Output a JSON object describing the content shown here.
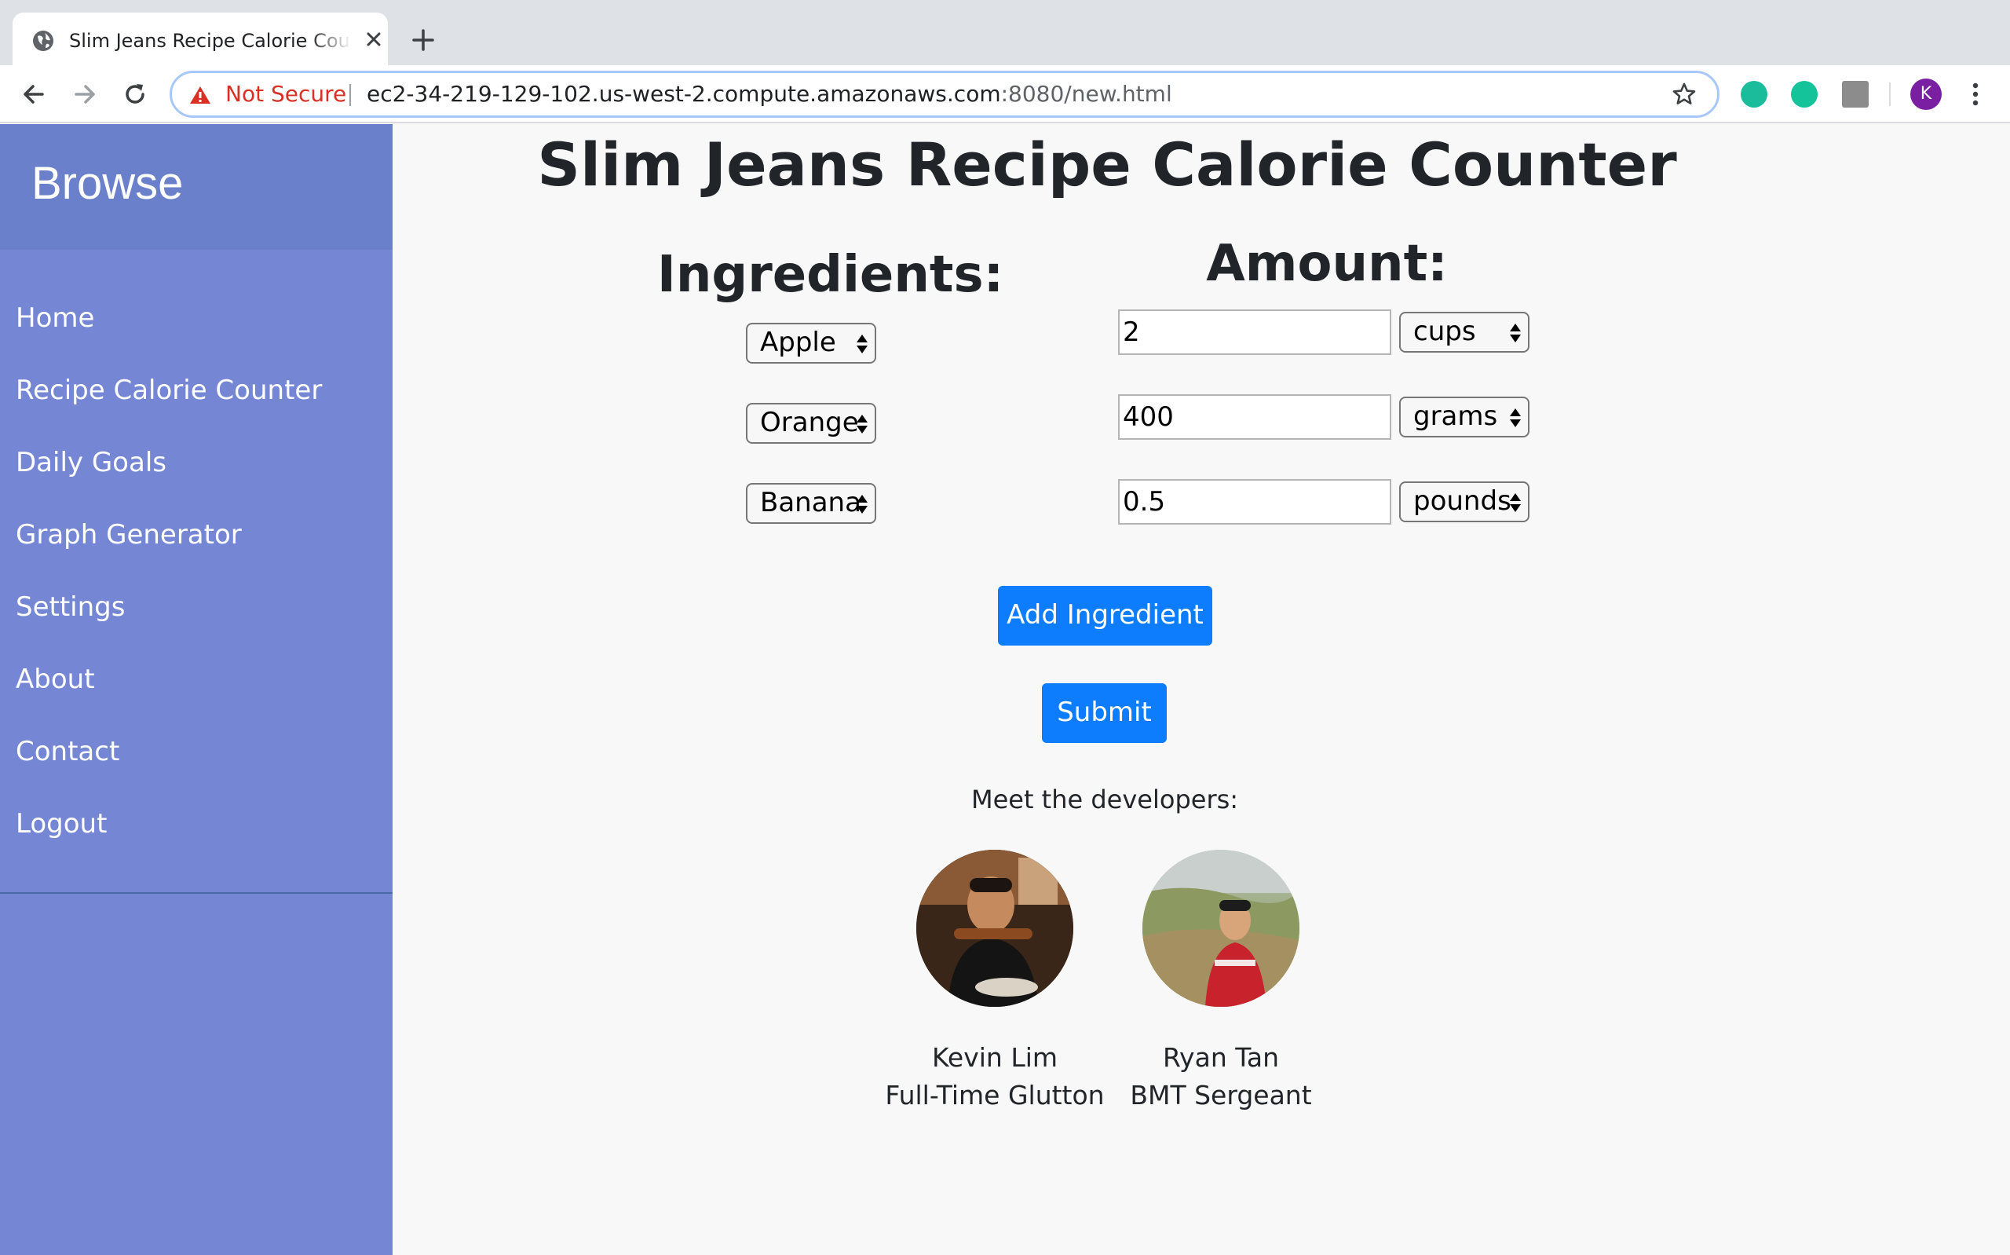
{
  "browser": {
    "tab_title": "Slim Jeans Recipe Calorie Counter",
    "security_label": "Not Secure",
    "url_host": "ec2-34-219-129-102.us-west-2.compute.amazonaws.com",
    "url_path": ":8080/new.html",
    "profile_initial": "K",
    "icons": [
      "globe-icon",
      "close-icon",
      "plus-icon",
      "back-arrow-icon",
      "forward-arrow-icon",
      "reload-icon",
      "warning-icon",
      "star-icon",
      "extension-icon",
      "profile-avatar",
      "menu-dots-icon"
    ]
  },
  "sidebar": {
    "title": "Browse",
    "items": [
      {
        "label": "Home"
      },
      {
        "label": "Recipe Calorie Counter"
      },
      {
        "label": "Daily Goals"
      },
      {
        "label": "Graph Generator"
      },
      {
        "label": "Settings"
      },
      {
        "label": "About"
      },
      {
        "label": "Contact"
      },
      {
        "label": "Logout"
      }
    ]
  },
  "main": {
    "title": "Slim Jeans Recipe Calorie Counter",
    "ingredients_heading": "Ingredients:",
    "amount_heading": "Amount:",
    "rows": [
      {
        "ingredient": "Apple",
        "amount": "2",
        "unit": "cups"
      },
      {
        "ingredient": "Orange",
        "amount": "400",
        "unit": "grams"
      },
      {
        "ingredient": "Banana",
        "amount": "0.5",
        "unit": "pounds"
      }
    ],
    "add_button": "Add Ingredient",
    "submit_button": "Submit",
    "meet_label": "Meet the developers:",
    "developers": [
      {
        "name": "Kevin Lim",
        "role": "Full-Time Glutton"
      },
      {
        "name": "Ryan Tan",
        "role": "BMT Sergeant"
      }
    ]
  },
  "colors": {
    "sidebar": "#7587d4",
    "sidebar_header": "#6b80cb",
    "button": "#0d7dfd",
    "not_secure": "#d93025"
  }
}
